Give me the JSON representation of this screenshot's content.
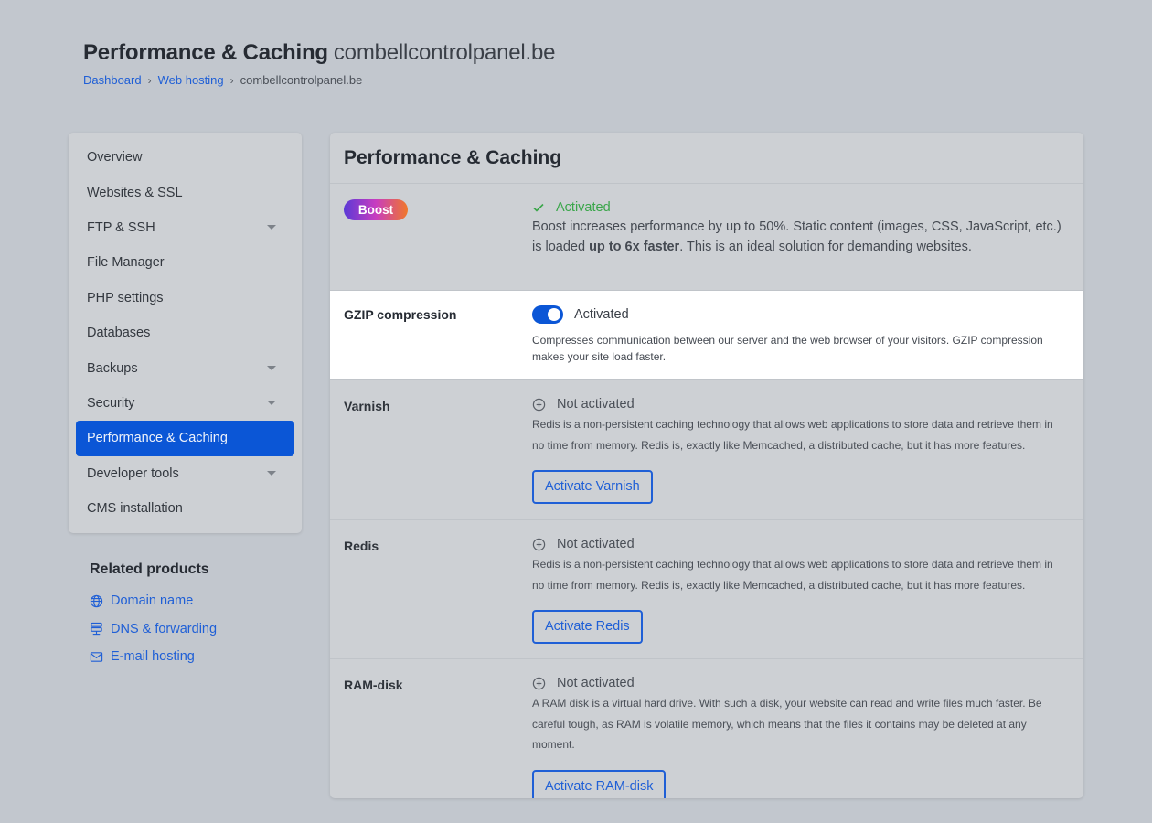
{
  "header": {
    "title": "Performance & Caching",
    "domain": "combellcontrolpanel.be",
    "breadcrumb": [
      "Dashboard",
      "Web hosting",
      "combellcontrolpanel.be"
    ]
  },
  "sidebar": {
    "items": [
      {
        "label": "Overview",
        "has_submenu": false
      },
      {
        "label": "Websites & SSL",
        "has_submenu": false
      },
      {
        "label": "FTP & SSH",
        "has_submenu": true
      },
      {
        "label": "File Manager",
        "has_submenu": false
      },
      {
        "label": "PHP settings",
        "has_submenu": false
      },
      {
        "label": "Databases",
        "has_submenu": false
      },
      {
        "label": "Backups",
        "has_submenu": true
      },
      {
        "label": "Security",
        "has_submenu": true
      },
      {
        "label": "Performance & Caching",
        "has_submenu": false,
        "active": true
      },
      {
        "label": "Developer tools",
        "has_submenu": true
      },
      {
        "label": "CMS installation",
        "has_submenu": false
      }
    ]
  },
  "related": {
    "title": "Related products",
    "items": [
      {
        "label": "Domain name",
        "icon": "globe-icon"
      },
      {
        "label": "DNS & forwarding",
        "icon": "dns-icon"
      },
      {
        "label": "E-mail hosting",
        "icon": "mail-icon"
      }
    ]
  },
  "main": {
    "title": "Performance & Caching",
    "boost": {
      "badge": "Boost",
      "status": "Activated",
      "desc_prefix": "Boost increases performance by up to 50%. Static content (images, CSS, JavaScript, etc.) is loaded ",
      "desc_bold": "up to 6x faster",
      "desc_suffix": ". This is an ideal solution for demanding websites."
    },
    "gzip": {
      "label": "GZIP compression",
      "status": "Activated",
      "enabled": true,
      "desc": "Compresses communication between our server and the web browser of your visitors. GZIP compression makes your site load faster."
    },
    "varnish": {
      "label": "Varnish",
      "status": "Not activated",
      "desc": "Redis is a non-persistent caching technology that allows web applications to store data and retrieve them in no time from memory. Redis is, exactly like Memcached, a distributed cache, but it has more features.",
      "button": "Activate Varnish"
    },
    "redis": {
      "label": "Redis",
      "status": "Not activated",
      "desc": "Redis is a non-persistent caching technology that allows web applications to store data and retrieve them in no time from memory. Redis is, exactly like Memcached, a distributed cache, but it has more features.",
      "button": "Activate Redis"
    },
    "ramdisk": {
      "label": "RAM-disk",
      "status": "Not activated",
      "desc": "A RAM disk is a virtual hard drive. With such a disk, your website can read and write files much faster. Be careful tough, as RAM is volatile memory, which means that the files it contains may be deleted at any moment.",
      "button": "Activate RAM-disk"
    }
  },
  "colors": {
    "accent": "#0b56d6",
    "link": "#1f5fd6",
    "success": "#3aa64a"
  }
}
